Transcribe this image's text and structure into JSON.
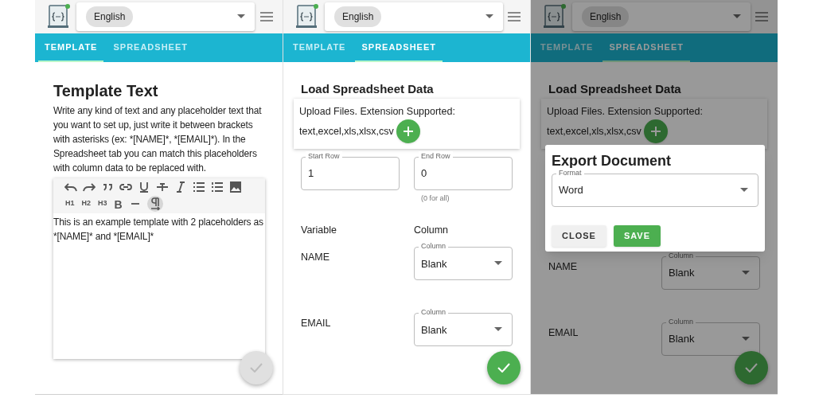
{
  "screens": [
    {
      "kind": "template",
      "language": "English",
      "tabs": [
        {
          "label": "TEMPLATE",
          "selected": true
        },
        {
          "label": "SPREADSHEET",
          "selected": false
        }
      ],
      "title": "Template Text",
      "description": "Write any kind of text and any placeholder text that you want to set up, just write it between brackets with asterisks (ex: *[NAME]*, *[EMAIL]*). In the Spreadsheet tab you can match this placeholders with column data to be replaced with.",
      "toolbar": {
        "headings": [
          "H1",
          "H2",
          "H3"
        ],
        "bold": "B",
        "format_marks_on": true
      },
      "editor_text": "This is an example template with 2 placeholders as *[NAME]* and *[EMAIL]*",
      "submit": {
        "disabled": true
      }
    },
    {
      "kind": "spreadsheet",
      "language": "English",
      "tabs": [
        {
          "label": "TEMPLATE",
          "selected": false
        },
        {
          "label": "SPREADSHEET",
          "selected": true
        }
      ],
      "title": "Load Spreadsheet Data",
      "upload": {
        "label": "Upload Files. Extension Supported:",
        "extensions": "text,excel,xls,xlsx,csv"
      },
      "rows": {
        "start_label": "Start Row",
        "start_value": "1",
        "end_label": "End Row",
        "end_value": "0",
        "end_hint": "(0 for all)"
      },
      "mapping_headers": [
        "Variable",
        "Column"
      ],
      "mappings": [
        {
          "variable": "NAME",
          "field_label": "Column",
          "value": "Blank"
        },
        {
          "variable": "EMAIL",
          "field_label": "Column",
          "value": "Blank"
        }
      ],
      "submit": {
        "disabled": false
      }
    },
    {
      "kind": "spreadsheet",
      "language": "English",
      "tabs": [
        {
          "label": "TEMPLATE",
          "selected": false
        },
        {
          "label": "SPREADSHEET",
          "selected": true
        }
      ],
      "title": "Load Spreadsheet Data",
      "upload": {
        "label": "Upload Files. Extension Supported:",
        "extensions": "text,excel,xls,xlsx,csv"
      },
      "mappings": [
        {
          "variable": "NAME",
          "field_label": "Column",
          "value": "Blank"
        },
        {
          "variable": "EMAIL",
          "field_label": "Column",
          "value": "Blank"
        }
      ],
      "submit": {
        "disabled": false
      },
      "dialog": {
        "title": "Export Document",
        "field_label": "Format",
        "value": "Word",
        "buttons": [
          {
            "label": "CLOSE",
            "kind": "plain"
          },
          {
            "label": "SAVE",
            "kind": "primary"
          }
        ]
      }
    }
  ]
}
